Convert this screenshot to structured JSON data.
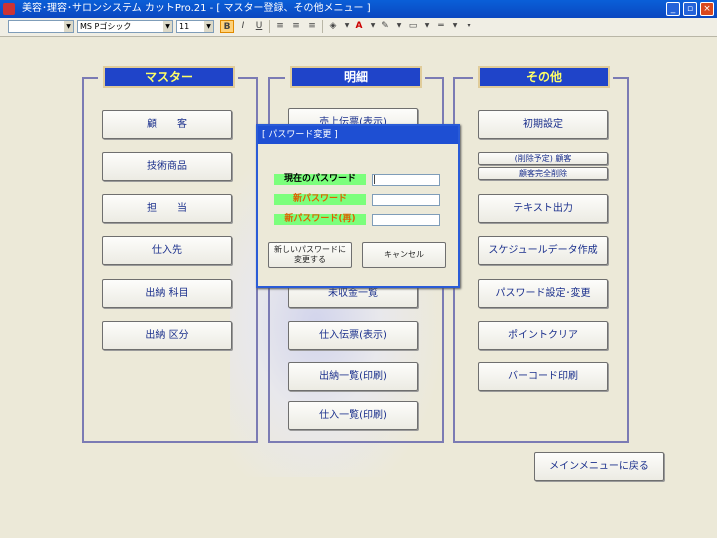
{
  "window": {
    "title": "美容･理容･サロンシステム  カットPro.21  - [ マスター登録、その他メニュー ]",
    "buttons": {
      "minimize": "_",
      "restore": "▫",
      "close": "×"
    }
  },
  "toolbar": {
    "style_value": "",
    "font_value": "MS Pゴシック",
    "size_value": "11",
    "bold": "B",
    "italic": "I",
    "underline": "U",
    "font_color_glyph": "A"
  },
  "groups": {
    "master": {
      "header": "マスター",
      "buttons": [
        "顧　　客",
        "技術商品",
        "担　　当",
        "仕入先",
        "出納 科目",
        "出納 区分"
      ]
    },
    "detail": {
      "header": "明細",
      "buttons": [
        "売上伝票(表示)",
        "未収金一覧",
        "仕入伝票(表示)",
        "出納一覧(印刷)",
        "仕入一覧(印刷)"
      ]
    },
    "other": {
      "header": "その他",
      "buttons": [
        "初期設定",
        "(削除予定) 顧客",
        "顧客完全削除",
        "テキスト出力",
        "スケジュールデータ作成",
        "パスワード設定･変更",
        "ポイントクリア",
        "バーコード印刷"
      ]
    }
  },
  "main_menu_button": "メインメニューに戻る",
  "dialog": {
    "title": "[ パスワード変更 ]",
    "fields": [
      {
        "label": "現在のパスワード",
        "value": "|"
      },
      {
        "label": "新パスワード",
        "value": ""
      },
      {
        "label": "新パスワード(再)",
        "value": ""
      }
    ],
    "ok_button": "新しいパスワードに\n変更する",
    "cancel_button": "キャンセル"
  },
  "colors": {
    "header_fill": "#1f44c9",
    "header_text_master": "#ffff66",
    "header_text_detail": "#ffffff",
    "header_text_other": "#ffff66",
    "label_green": "#7cff7c",
    "label_text_current": "#000000",
    "label_text_new": "#e06000"
  }
}
